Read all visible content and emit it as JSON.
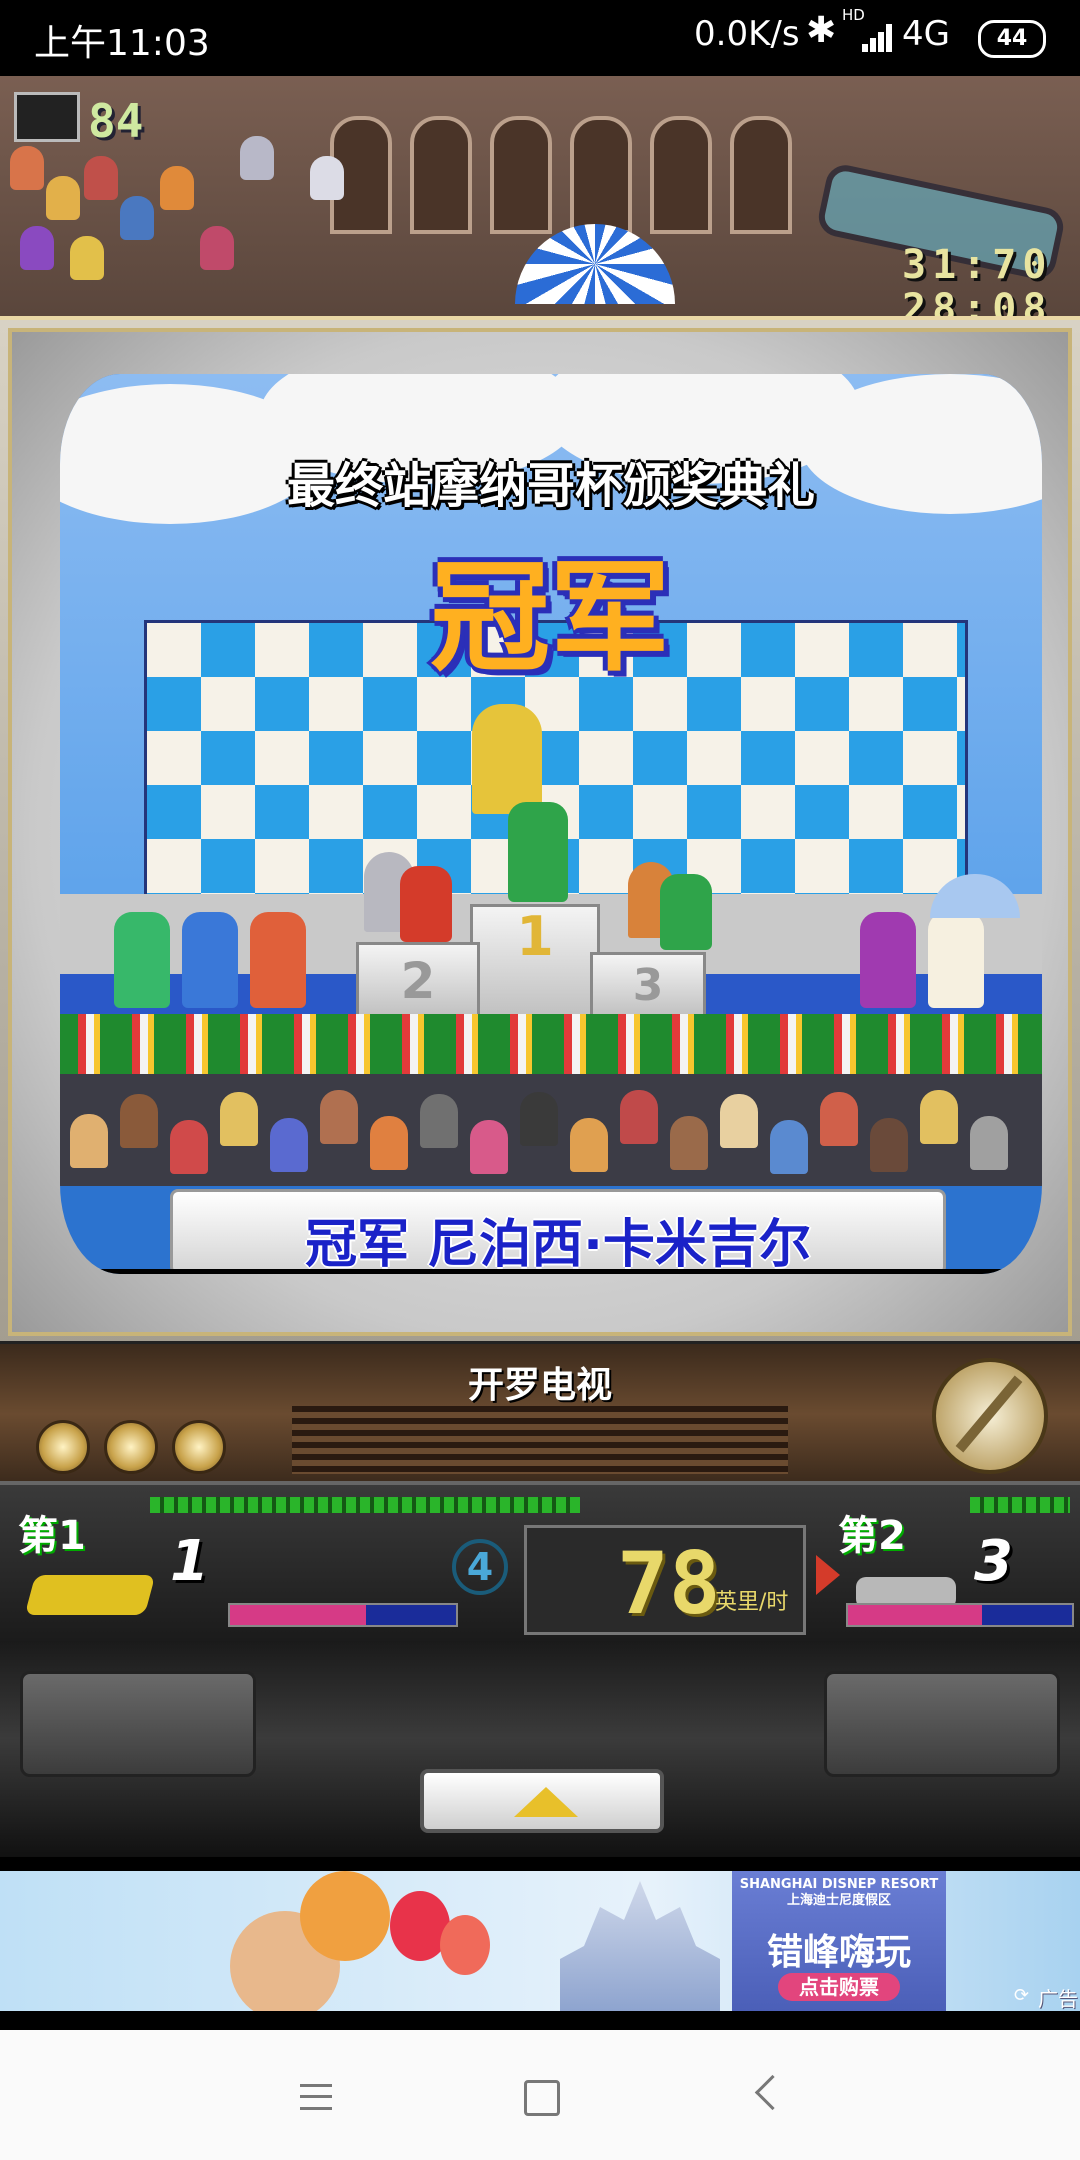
{
  "status_bar": {
    "time": "上午11:03",
    "network_speed": "0.0K/s",
    "signal_label": "HD",
    "network_type": "4G",
    "battery": "44"
  },
  "scene": {
    "score": "84",
    "time_line1": "31:70",
    "time_line2": "28:08"
  },
  "tv_screen": {
    "ceremony_title": "最终站摩纳哥杯颁奖典礼",
    "banner": "冠军",
    "podium_1": "1",
    "podium_2": "2",
    "podium_3": "3",
    "caption": "冠军 尼泊西·卡米吉尔"
  },
  "tv_panel": {
    "channel_name": "开罗电视"
  },
  "hud": {
    "player1_rank_label": "第1",
    "player1_number": "1",
    "lap": "4",
    "speed": "78",
    "speed_unit": "英里/时",
    "player2_rank_label": "第2",
    "player2_number": "3",
    "player1_health": 0.6,
    "player2_health": 0.6
  },
  "ad": {
    "brand": "SHANGHAI DISNEP RESORT 上海迪士尼度假区",
    "slogan": "错峰嗨玩",
    "cta": "点击购票",
    "label": "广告"
  },
  "icons": [
    "bluetooth-icon",
    "signal-icon",
    "battery-icon",
    "monitor-icon",
    "trophy-icon",
    "dial-icon",
    "up-arrow-icon",
    "menu-icon",
    "home-icon",
    "back-icon",
    "ad-refresh-icon"
  ],
  "colors": {
    "caption_text": "#1a22c8",
    "banner_fill": "#ffb020",
    "banner_outline": "#2b2fb8",
    "speed_text": "#e8d86a",
    "ad_cta": "#e2457d"
  }
}
